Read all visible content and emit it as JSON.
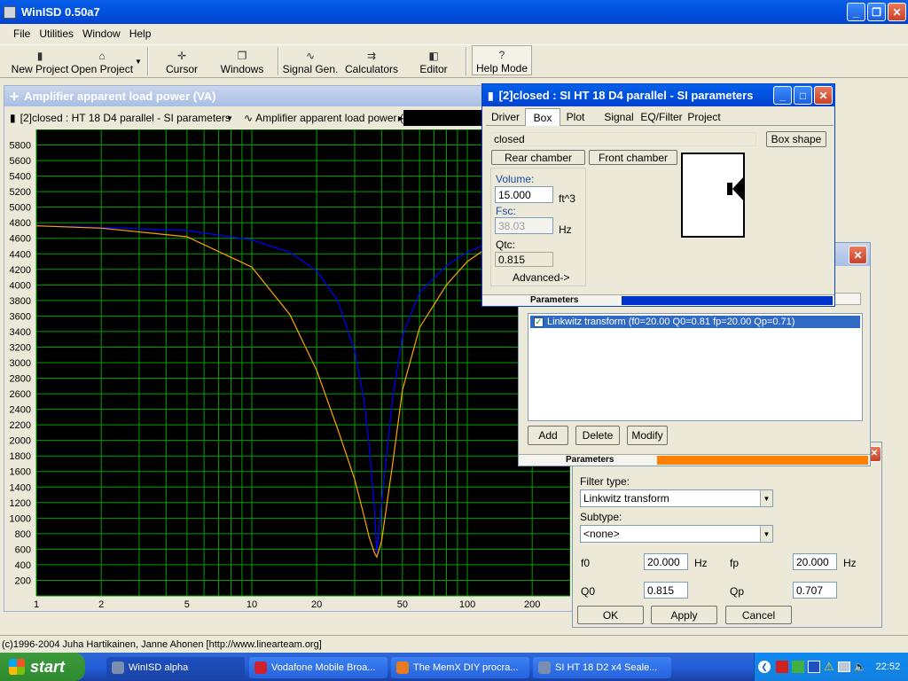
{
  "app": {
    "title": "WinISD 0.50a7",
    "menu": [
      "File",
      "Utilities",
      "Window",
      "Help"
    ],
    "toolbar": [
      {
        "label": "New Project",
        "icon": "new-project-icon"
      },
      {
        "label": "Open Project",
        "icon": "open-project-icon"
      },
      {
        "label": "Cursor",
        "icon": "cursor-icon"
      },
      {
        "label": "Windows",
        "icon": "windows-icon"
      },
      {
        "label": "Signal Gen.",
        "icon": "signal-gen-icon"
      },
      {
        "label": "Calculators",
        "icon": "calculators-icon"
      },
      {
        "label": "Editor",
        "icon": "editor-icon"
      },
      {
        "label": "Help Mode",
        "icon": "help-mode-icon"
      }
    ],
    "status_text": "(c)1996-2004 Juha Hartikainen, Janne Ahonen [http://www.linearteam.org]"
  },
  "graph_window": {
    "title": "Amplifier apparent load power (VA)",
    "project_combo": "[2]closed : HT 18 D4 parallel - SI parameters",
    "graph_combo": "Amplifier apparent load power (V"
  },
  "chart_data": {
    "type": "line",
    "title": "Amplifier apparent load power (VA)",
    "x_scale": "log",
    "xlim": [
      1,
      300
    ],
    "ylim": [
      0,
      6000
    ],
    "y_ticks": [
      200,
      400,
      600,
      800,
      1000,
      1200,
      1400,
      1600,
      1800,
      2000,
      2200,
      2400,
      2600,
      2800,
      3000,
      3200,
      3400,
      3600,
      3800,
      4000,
      4200,
      4400,
      4600,
      4800,
      5000,
      5200,
      5400,
      5600,
      5800
    ],
    "x_ticks": [
      1,
      2,
      5,
      10,
      20,
      50,
      100,
      200
    ],
    "grid": true,
    "background": "#000000",
    "grid_color": "#00a000",
    "series": [
      {
        "color": "#0000ff",
        "x": [
          1,
          2,
          5,
          10,
          15,
          20,
          25,
          30,
          33,
          35,
          37,
          38,
          40,
          45,
          50,
          60,
          80,
          100,
          130
        ],
        "y": [
          4760,
          4740,
          4700,
          4580,
          4420,
          4180,
          3800,
          3150,
          2550,
          1950,
          1150,
          560,
          1200,
          2550,
          3350,
          3900,
          4250,
          4420,
          4560
        ]
      },
      {
        "color": "#ffa500",
        "x": [
          1,
          2,
          5,
          10,
          15,
          20,
          25,
          30,
          33,
          35,
          37,
          38,
          40,
          45,
          50,
          60,
          80,
          100,
          130
        ],
        "y": [
          4760,
          4730,
          4620,
          4230,
          3620,
          2900,
          2150,
          1500,
          1050,
          760,
          560,
          500,
          700,
          1700,
          2650,
          3450,
          4000,
          4300,
          4520
        ]
      }
    ]
  },
  "params_window": {
    "title": "[2]closed : SI HT 18 D4 parallel - SI parameters",
    "tabs": [
      "Driver",
      "Box",
      "Plot",
      "Signal",
      "EQ/Filter",
      "Project"
    ],
    "active_tab": "Box",
    "box_type": "closed",
    "box_shape_label": "Box shape",
    "rear_chamber_label": "Rear chamber",
    "front_chamber_label": "Front chamber",
    "volume_label": "Volume:",
    "volume_value": "15.000",
    "volume_unit": "ft^3",
    "fsc_label": "Fsc:",
    "fsc_value": "38.03",
    "fsc_unit": "Hz",
    "qtc_label": "Qtc:",
    "qtc_value": "0.815",
    "advanced_label": "Advanced->",
    "status_label": "Parameters",
    "status_color": "#0033cc"
  },
  "eq_window": {
    "filter_item": "Linkwitz transform (f0=20.00 Q0=0.81 fp=20.00 Qp=0.71)",
    "add_label": "Add",
    "delete_label": "Delete",
    "modify_label": "Modify",
    "status_label": "Parameters",
    "status_color": "#ff8000"
  },
  "filter_dialog": {
    "filter_type_label": "Filter type:",
    "filter_type_value": "Linkwitz transform",
    "subtype_label": "Subtype:",
    "subtype_value": "<none>",
    "f0_label": "f0",
    "f0_value": "20.000",
    "f0_unit": "Hz",
    "fp_label": "fp",
    "fp_value": "20.000",
    "fp_unit": "Hz",
    "q0_label": "Q0",
    "q0_value": "0.815",
    "qp_label": "Qp",
    "qp_value": "0.707",
    "ok_label": "OK",
    "apply_label": "Apply",
    "cancel_label": "Cancel"
  },
  "taskbar": {
    "start_label": "start",
    "items": [
      {
        "label": "WinISD alpha",
        "color": "#7a8fb0"
      },
      {
        "label": "Vodafone Mobile Broa...",
        "color": "#d0202a"
      },
      {
        "label": "The MemX DIY procra...",
        "color": "#e87a20"
      },
      {
        "label": "SI HT 18 D2 x4 Seale...",
        "color": "#7a8fb0"
      }
    ],
    "clock": "22:52"
  }
}
